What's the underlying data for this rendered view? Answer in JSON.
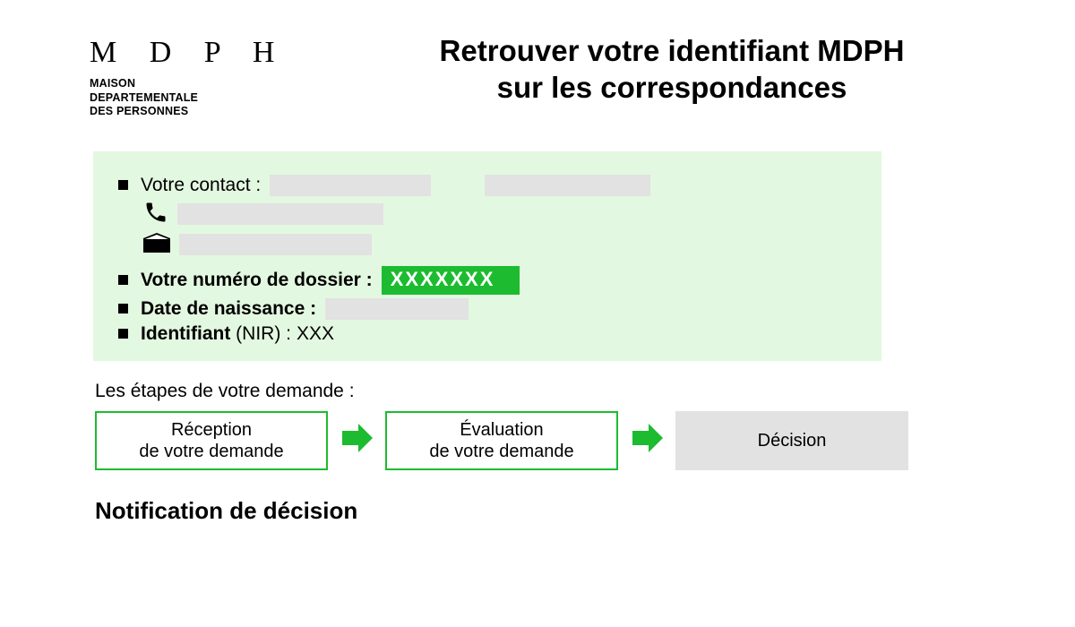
{
  "logo": {
    "letters": "M D P H",
    "sub1": "MAISON",
    "sub2": "DEPARTEMENTALE",
    "sub3": "DES PERSONNES"
  },
  "title": {
    "line1": "Retrouver votre identifiant MDPH",
    "line2": "sur les correspondances"
  },
  "card": {
    "contact_label": "Votre contact :",
    "dossier_label": "Votre numéro de dossier :",
    "dossier_value": "XXXXXXX",
    "dob_label": "Date de naissance :",
    "nir_label_bold": "Identifiant",
    "nir_label_paren": " (NIR) : ",
    "nir_value": "XXX"
  },
  "steps": {
    "title": "Les étapes de votre demande :",
    "s1_line1": "Réception",
    "s1_line2": "de votre demande",
    "s2_line1": "Évaluation",
    "s2_line2": "de votre demande",
    "s3": "Décision"
  },
  "subhead": "Notification de décision",
  "colors": {
    "green": "#1dbb30",
    "light_green": "#e3f8e0",
    "mask": "#e2e2e2"
  }
}
